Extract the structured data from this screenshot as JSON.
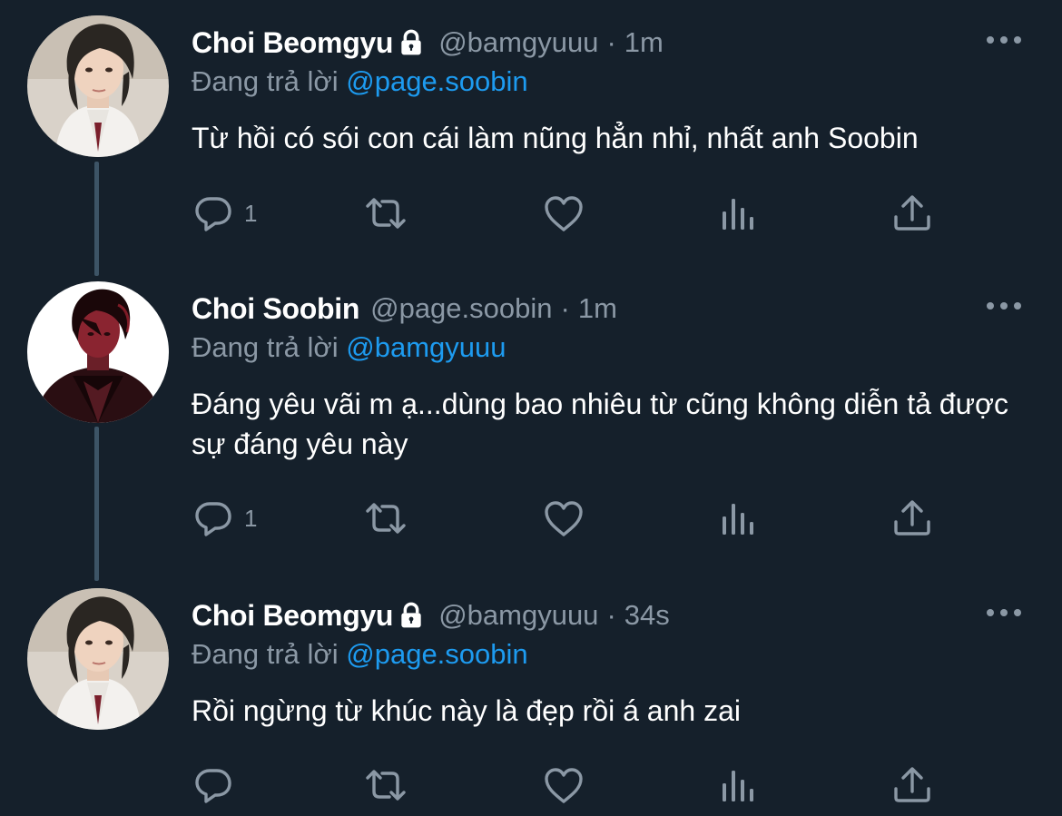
{
  "colors": {
    "background": "#15202b",
    "secondary_text": "#8b98a5",
    "link": "#1d9bf0",
    "thread_line": "#3d5466"
  },
  "tweets": [
    {
      "name": "Choi Beomgyu",
      "locked": true,
      "handle": "@bamgyuuu",
      "dot": "·",
      "time": "1m",
      "reply_prefix": "Đang trả lời",
      "reply_to": "@page.soobin",
      "text": "Từ hồi có sói con cái làm nũng hẳn nhỉ, nhất anh Soobin",
      "reply_count": "1",
      "avatar_icon": "profile-photo"
    },
    {
      "name": "Choi Soobin",
      "locked": false,
      "handle": "@page.soobin",
      "dot": "·",
      "time": "1m",
      "reply_prefix": "Đang trả lời",
      "reply_to": "@bamgyuuu",
      "text": "Đáng yêu vãi m ạ...dùng bao nhiêu từ cũng không diễn tả được sự đáng yêu này",
      "reply_count": "1",
      "avatar_icon": "profile-photo"
    },
    {
      "name": "Choi Beomgyu",
      "locked": true,
      "handle": "@bamgyuuu",
      "dot": "·",
      "time": "34s",
      "reply_prefix": "Đang trả lời",
      "reply_to": "@page.soobin",
      "text": "Rồi ngừng từ khúc này là đẹp rồi á anh zai",
      "reply_count": "",
      "avatar_icon": "profile-photo"
    }
  ],
  "icons": {
    "more": "more-icon",
    "lock": "lock-icon",
    "reply": "reply-icon",
    "retweet": "retweet-icon",
    "like": "like-icon",
    "views": "views-icon",
    "share": "share-icon"
  }
}
